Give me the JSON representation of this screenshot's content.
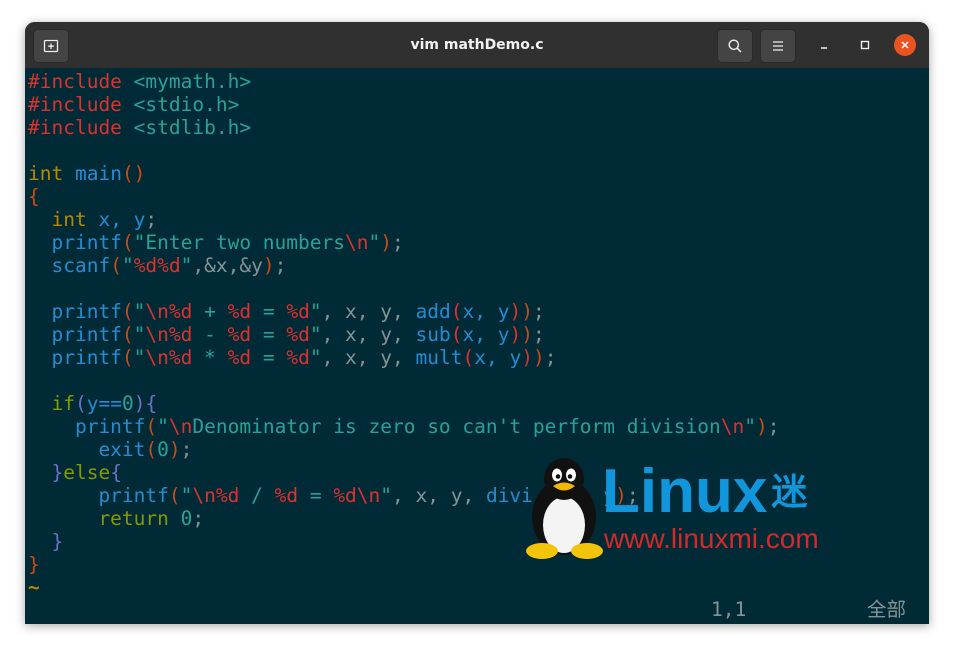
{
  "window": {
    "title": "vim mathDemo.c"
  },
  "editor": {
    "lines": [
      [
        [
          "pp",
          "#include"
        ],
        [
          "inc",
          " <mymath.h>"
        ]
      ],
      [
        [
          "pp",
          "#include"
        ],
        [
          "inc",
          " <stdio.h>"
        ]
      ],
      [
        [
          "pp",
          "#include"
        ],
        [
          "inc",
          " <stdlib.h>"
        ]
      ],
      [],
      [
        [
          "ty",
          "int"
        ],
        [
          "id",
          " main"
        ],
        [
          "br",
          "()"
        ]
      ],
      [
        [
          "br",
          "{"
        ]
      ],
      [
        [
          "pl",
          "  "
        ],
        [
          "ty",
          "int"
        ],
        [
          "id",
          " x, y"
        ],
        [
          "pl",
          ";"
        ]
      ],
      [
        [
          "id",
          "  printf"
        ],
        [
          "br",
          "("
        ],
        [
          "st",
          "\"Enter two numbers"
        ],
        [
          "es",
          "\\n"
        ],
        [
          "st",
          "\""
        ],
        [
          "br",
          ")"
        ],
        [
          "pl",
          ";"
        ]
      ],
      [
        [
          "id",
          "  scanf"
        ],
        [
          "br",
          "("
        ],
        [
          "st",
          "\""
        ],
        [
          "es",
          "%d%d"
        ],
        [
          "st",
          "\""
        ],
        [
          "pl",
          ",&x,&y"
        ],
        [
          "br",
          ")"
        ],
        [
          "pl",
          ";"
        ]
      ],
      [],
      [
        [
          "id",
          "  printf"
        ],
        [
          "br",
          "("
        ],
        [
          "st",
          "\""
        ],
        [
          "es",
          "\\n%d"
        ],
        [
          "st",
          " + "
        ],
        [
          "es",
          "%d"
        ],
        [
          "st",
          " = "
        ],
        [
          "es",
          "%d"
        ],
        [
          "st",
          "\""
        ],
        [
          "pl",
          ", x, y, "
        ],
        [
          "id",
          "add"
        ],
        [
          "es",
          "("
        ],
        [
          "id",
          "x, y"
        ],
        [
          "es",
          ")"
        ],
        [
          "br",
          ")"
        ],
        [
          "pl",
          ";"
        ]
      ],
      [
        [
          "id",
          "  printf"
        ],
        [
          "br",
          "("
        ],
        [
          "st",
          "\""
        ],
        [
          "es",
          "\\n%d"
        ],
        [
          "st",
          " - "
        ],
        [
          "es",
          "%d"
        ],
        [
          "st",
          " = "
        ],
        [
          "es",
          "%d"
        ],
        [
          "st",
          "\""
        ],
        [
          "pl",
          ", x, y, "
        ],
        [
          "id",
          "sub"
        ],
        [
          "es",
          "("
        ],
        [
          "id",
          "x, y"
        ],
        [
          "es",
          ")"
        ],
        [
          "br",
          ")"
        ],
        [
          "pl",
          ";"
        ]
      ],
      [
        [
          "id",
          "  printf"
        ],
        [
          "br",
          "("
        ],
        [
          "st",
          "\""
        ],
        [
          "es",
          "\\n%d"
        ],
        [
          "st",
          " * "
        ],
        [
          "es",
          "%d"
        ],
        [
          "st",
          " = "
        ],
        [
          "es",
          "%d"
        ],
        [
          "st",
          "\""
        ],
        [
          "pl",
          ", x, y, "
        ],
        [
          "id",
          "mult"
        ],
        [
          "es",
          "("
        ],
        [
          "id",
          "x, y"
        ],
        [
          "es",
          ")"
        ],
        [
          "br",
          ")"
        ],
        [
          "pl",
          ";"
        ]
      ],
      [],
      [
        [
          "kw",
          "  if"
        ],
        [
          "pn",
          "("
        ],
        [
          "id",
          "y=="
        ],
        [
          "nu",
          "0"
        ],
        [
          "pn",
          "){"
        ]
      ],
      [
        [
          "id",
          "    printf"
        ],
        [
          "br",
          "("
        ],
        [
          "st",
          "\""
        ],
        [
          "es",
          "\\n"
        ],
        [
          "st",
          "Denominator is zero so can't perform division"
        ],
        [
          "es",
          "\\n"
        ],
        [
          "st",
          "\""
        ],
        [
          "br",
          ")"
        ],
        [
          "pl",
          ";"
        ]
      ],
      [
        [
          "id",
          "      exit"
        ],
        [
          "br",
          "("
        ],
        [
          "nu",
          "0"
        ],
        [
          "br",
          ")"
        ],
        [
          "pl",
          ";"
        ]
      ],
      [
        [
          "pn",
          "  }"
        ],
        [
          "kw",
          "else"
        ],
        [
          "pn",
          "{"
        ]
      ],
      [
        [
          "id",
          "      printf"
        ],
        [
          "br",
          "("
        ],
        [
          "st",
          "\""
        ],
        [
          "es",
          "\\n%d"
        ],
        [
          "st",
          " / "
        ],
        [
          "es",
          "%d"
        ],
        [
          "st",
          " = "
        ],
        [
          "es",
          "%d\\n"
        ],
        [
          "st",
          "\""
        ],
        [
          "pl",
          ", x, y, "
        ],
        [
          "id",
          "divi"
        ],
        [
          "pl",
          "      "
        ],
        [
          "id",
          "y"
        ],
        [
          "br",
          ")"
        ],
        [
          "pl",
          ";"
        ]
      ],
      [
        [
          "kw",
          "      return"
        ],
        [
          "nu",
          " 0"
        ],
        [
          "pl",
          ";"
        ]
      ],
      [
        [
          "pn",
          "  }"
        ]
      ],
      [
        [
          "br",
          "}"
        ]
      ]
    ],
    "tilde": "~"
  },
  "statusline": {
    "position": "1,1",
    "scroll": "全部"
  },
  "watermark": {
    "brand": "Linux",
    "brand_char": "迷",
    "url": "www.linuxmi.com"
  },
  "colors": {
    "terminal_bg": "#002b36",
    "titlebar_bg": "#303030",
    "close_button": "#e95420",
    "brand_blue": "#1296db"
  },
  "icons": {
    "new_tab": "new-tab-icon",
    "search": "search-icon",
    "menu": "hamburger-menu-icon",
    "minimize": "minimize-icon",
    "maximize": "maximize-icon",
    "close": "close-icon",
    "penguin": "tux-penguin-icon"
  }
}
